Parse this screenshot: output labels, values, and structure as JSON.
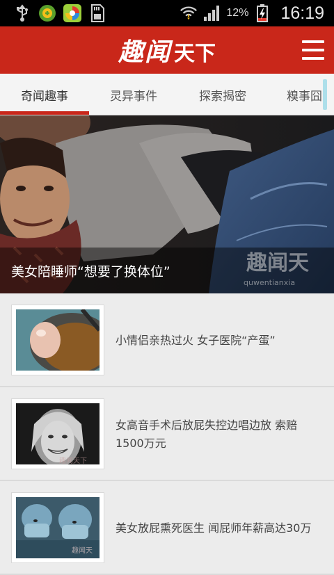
{
  "status_bar": {
    "icons": [
      "usb-icon",
      "app-icon-green",
      "app-icon-colorful",
      "sd-card-icon",
      "wifi-icon",
      "signal-icon",
      "battery-charging-icon"
    ],
    "battery_percent": "12%",
    "time": "16:19"
  },
  "header": {
    "logo_main": "趣闻",
    "logo_sub": "天下",
    "menu_icon": "hamburger-menu-icon"
  },
  "tabs": [
    {
      "label": "奇闻趣事",
      "active": true
    },
    {
      "label": "灵异事件",
      "active": false
    },
    {
      "label": "探索揭密",
      "active": false
    },
    {
      "label": "糗事囧",
      "active": false
    }
  ],
  "hero": {
    "caption": "美女陪睡师“想要了换体位”",
    "watermark": "趣闻天",
    "watermark_sub": "quwentianxia"
  },
  "articles": [
    {
      "title": "小情侣亲热过火 女子医院“产蛋”",
      "thumb": "egg-in-pan-image"
    },
    {
      "title": "女高音手术后放屁失控边唱边放 索赔1500万元",
      "thumb": "smiling-woman-portrait-image"
    },
    {
      "title": "美女放屁熏死医生 闻屁师年薪高达30万",
      "thumb": "surgeons-operating-room-image"
    }
  ],
  "colors": {
    "brand_red": "#c9271a",
    "tab_background": "#f4f4f4",
    "list_background": "#ececec"
  }
}
